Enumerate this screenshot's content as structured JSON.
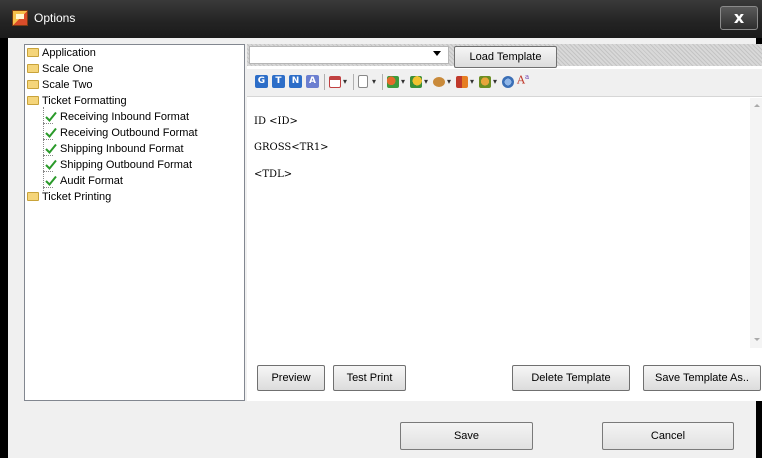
{
  "window": {
    "title": "Options",
    "close_glyph": "x"
  },
  "tree": {
    "items": [
      {
        "label": "Application",
        "icon": "folder-icon"
      },
      {
        "label": "Scale One",
        "icon": "folder-icon"
      },
      {
        "label": "Scale Two",
        "icon": "folder-icon"
      },
      {
        "label": "Ticket Formatting",
        "icon": "folder-icon"
      },
      {
        "label": "Receiving Inbound Format",
        "icon": "checkmark-icon"
      },
      {
        "label": "Receiving Outbound Format",
        "icon": "checkmark-icon"
      },
      {
        "label": "Shipping Inbound Format",
        "icon": "checkmark-icon"
      },
      {
        "label": "Shipping Outbound Format",
        "icon": "checkmark-icon"
      },
      {
        "label": "Audit Format",
        "icon": "checkmark-icon"
      },
      {
        "label": "Ticket Printing",
        "icon": "folder-icon"
      }
    ]
  },
  "template": {
    "selected": "",
    "load_label": "Load Template"
  },
  "toolbar": {
    "letter_buttons": [
      "G",
      "T",
      "N",
      "A"
    ],
    "dropdown_glyph": "▾",
    "font_glyph": "A"
  },
  "editor": {
    "lines": [
      "ID <ID>",
      "GROSS<TR1>",
      "<TDL>"
    ]
  },
  "buttons": {
    "preview": "Preview",
    "test_print": "Test Print",
    "delete_template": "Delete Template",
    "save_template_as": "Save Template As.."
  },
  "footer": {
    "save": "Save",
    "cancel": "Cancel"
  },
  "colors": {
    "titlebar": "#232323",
    "letter_g": "#2d6ec8",
    "letter_t": "#2d6ec8",
    "letter_n": "#2d6ec8",
    "letter_a": "#6c7fd0",
    "checkmark": "#2a9a2a"
  }
}
